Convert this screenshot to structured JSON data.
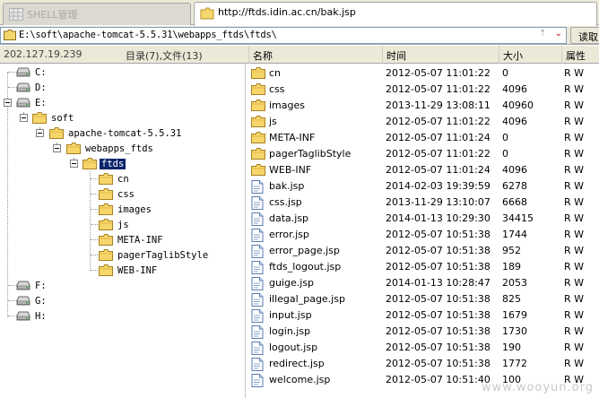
{
  "tabs": [
    {
      "label": "SHELL管理",
      "active": false
    },
    {
      "label": "http://ftds.idin.ac.cn/bak.jsp",
      "active": true
    }
  ],
  "address": {
    "path": "E:\\soft\\apache-tomcat-5.5.31\\webapps_ftds\\ftds\\",
    "up_glyph": "⇡",
    "dropdown_glyph": "⌄",
    "read_button": "读取"
  },
  "header": {
    "ip": "202.127.19.239",
    "dir_info": "目录(7),文件(13)",
    "col_name": "名称",
    "col_time": "时间",
    "col_size": "大小",
    "col_attr": "属性"
  },
  "tree": [
    {
      "label": "C:",
      "type": "drive"
    },
    {
      "label": "D:",
      "type": "drive"
    },
    {
      "label": "E:",
      "type": "drive"
    },
    {
      "label": "soft",
      "type": "folder"
    },
    {
      "label": "apache-tomcat-5.5.31",
      "type": "folder"
    },
    {
      "label": "webapps_ftds",
      "type": "folder"
    },
    {
      "label": "ftds",
      "type": "folder",
      "selected": true
    },
    {
      "label": "cn",
      "type": "folder"
    },
    {
      "label": "css",
      "type": "folder"
    },
    {
      "label": "images",
      "type": "folder"
    },
    {
      "label": "js",
      "type": "folder"
    },
    {
      "label": "META-INF",
      "type": "folder"
    },
    {
      "label": "pagerTaglibStyle",
      "type": "folder"
    },
    {
      "label": "WEB-INF",
      "type": "folder"
    },
    {
      "label": "F:",
      "type": "drive"
    },
    {
      "label": "G:",
      "type": "drive"
    },
    {
      "label": "H:",
      "type": "drive"
    }
  ],
  "files": [
    {
      "name": "cn",
      "time": "2012-05-07 11:01:22",
      "size": "0",
      "attr": "R W",
      "type": "folder"
    },
    {
      "name": "css",
      "time": "2012-05-07 11:01:22",
      "size": "4096",
      "attr": "R W",
      "type": "folder"
    },
    {
      "name": "images",
      "time": "2013-11-29 13:08:11",
      "size": "40960",
      "attr": "R W",
      "type": "folder"
    },
    {
      "name": "js",
      "time": "2012-05-07 11:01:22",
      "size": "4096",
      "attr": "R W",
      "type": "folder"
    },
    {
      "name": "META-INF",
      "time": "2012-05-07 11:01:24",
      "size": "0",
      "attr": "R W",
      "type": "folder"
    },
    {
      "name": "pagerTaglibStyle",
      "time": "2012-05-07 11:01:22",
      "size": "0",
      "attr": "R W",
      "type": "folder"
    },
    {
      "name": "WEB-INF",
      "time": "2012-05-07 11:01:24",
      "size": "4096",
      "attr": "R W",
      "type": "folder"
    },
    {
      "name": "bak.jsp",
      "time": "2014-02-03 19:39:59",
      "size": "6278",
      "attr": "R W",
      "type": "file"
    },
    {
      "name": "css.jsp",
      "time": "2013-11-29 13:10:07",
      "size": "6668",
      "attr": "R W",
      "type": "file"
    },
    {
      "name": "data.jsp",
      "time": "2014-01-13 10:29:30",
      "size": "34415",
      "attr": "R W",
      "type": "file"
    },
    {
      "name": "error.jsp",
      "time": "2012-05-07 10:51:38",
      "size": "1744",
      "attr": "R W",
      "type": "file"
    },
    {
      "name": "error_page.jsp",
      "time": "2012-05-07 10:51:38",
      "size": "952",
      "attr": "R W",
      "type": "file"
    },
    {
      "name": "ftds_logout.jsp",
      "time": "2012-05-07 10:51:38",
      "size": "189",
      "attr": "R W",
      "type": "file"
    },
    {
      "name": "guige.jsp",
      "time": "2014-01-13 10:28:47",
      "size": "2053",
      "attr": "R W",
      "type": "file"
    },
    {
      "name": "illegal_page.jsp",
      "time": "2012-05-07 10:51:38",
      "size": "825",
      "attr": "R W",
      "type": "file"
    },
    {
      "name": "input.jsp",
      "time": "2012-05-07 10:51:38",
      "size": "1679",
      "attr": "R W",
      "type": "file"
    },
    {
      "name": "login.jsp",
      "time": "2012-05-07 10:51:38",
      "size": "1730",
      "attr": "R W",
      "type": "file"
    },
    {
      "name": "logout.jsp",
      "time": "2012-05-07 10:51:38",
      "size": "190",
      "attr": "R W",
      "type": "file"
    },
    {
      "name": "redirect.jsp",
      "time": "2012-05-07 10:51:38",
      "size": "1772",
      "attr": "R W",
      "type": "file"
    },
    {
      "name": "welcome.jsp",
      "time": "2012-05-07 10:51:40",
      "size": "100",
      "attr": "R W",
      "type": "file"
    }
  ],
  "watermark": "www.wooyun.org"
}
